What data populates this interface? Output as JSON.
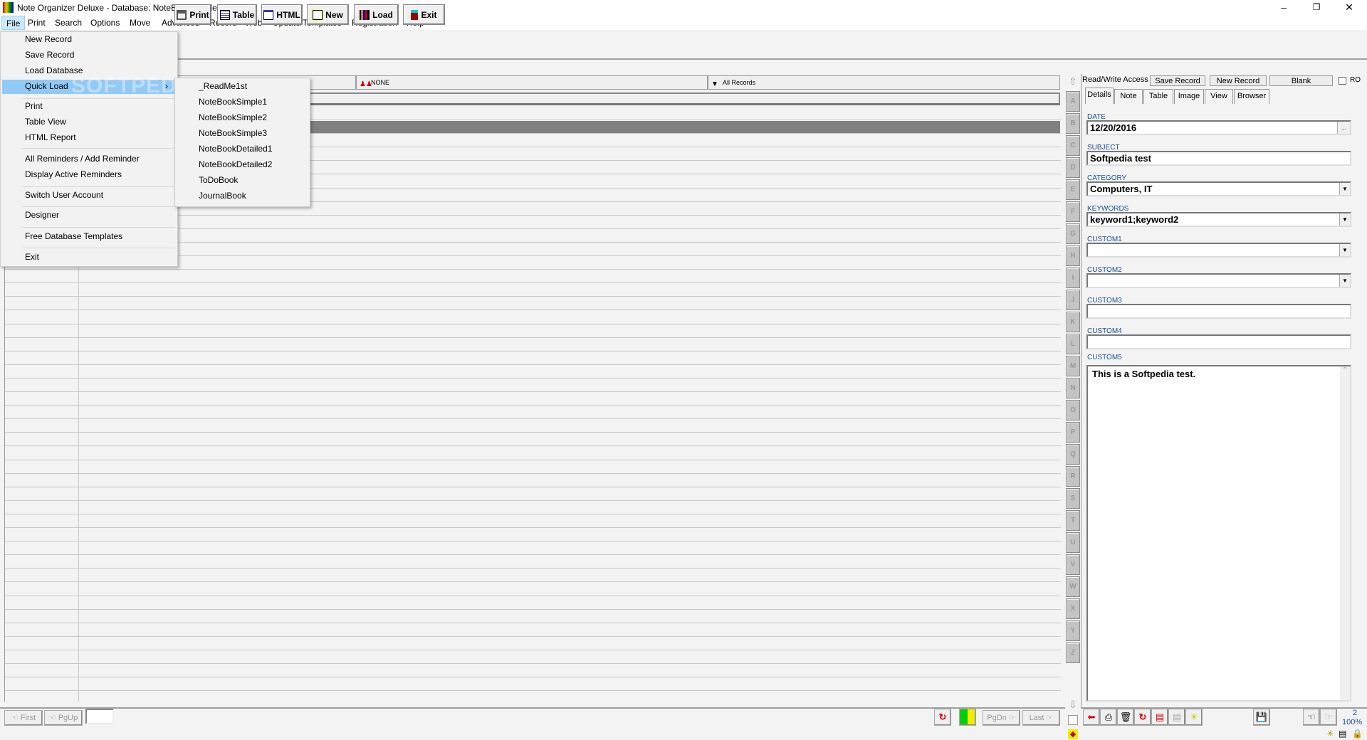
{
  "window": {
    "title": "Note Organizer Deluxe - Database: NoteBookDetailed2",
    "controls": [
      "minimize",
      "restore",
      "close"
    ]
  },
  "menubar": [
    "File",
    "Print",
    "Search",
    "Options",
    "Move",
    "Advanced",
    "Record",
    "Web",
    "Update/Templates",
    "Registration",
    "Help"
  ],
  "toolbar": {
    "buttons": [
      "Print",
      "Table",
      "HTML",
      "New",
      "Load",
      "Exit"
    ]
  },
  "grid": {
    "header": {
      "col2": "NONE",
      "col3": "All Records"
    }
  },
  "alphabet": [
    "A",
    "B",
    "C",
    "D",
    "E",
    "F",
    "G",
    "H",
    "I",
    "J",
    "K",
    "L",
    "M",
    "N",
    "O",
    "P",
    "Q",
    "R",
    "S",
    "T",
    "U",
    "V",
    "W",
    "X",
    "Y",
    "Z"
  ],
  "right_panel": {
    "access": "Read/Write Access",
    "save_record": "Save Record",
    "new_record": "New Record",
    "blank": "Blank",
    "ro": "RO",
    "tabs": [
      "Details",
      "Note",
      "Table",
      "Image",
      "View",
      "Browser"
    ],
    "fields": [
      {
        "label": "DATE",
        "value": "12/20/2016",
        "button": "..."
      },
      {
        "label": "SUBJECT",
        "value": "Softpedia test"
      },
      {
        "label": "CATEGORY",
        "value": "Computers, IT",
        "dropdown": true
      },
      {
        "label": "KEYWORDS",
        "value": "keyword1;keyword2",
        "dropdown": true
      },
      {
        "label": "CUSTOM1",
        "value": "",
        "dropdown": true
      },
      {
        "label": "CUSTOM2",
        "value": "",
        "dropdown": true
      },
      {
        "label": "CUSTOM3",
        "value": ""
      },
      {
        "label": "CUSTOM4",
        "value": ""
      }
    ],
    "custom5": {
      "label": "CUSTOM5",
      "value": "This is a Softpedia test."
    },
    "record_number": "2",
    "zoom": "100%"
  },
  "bottom_nav": {
    "first": "First",
    "pgup": "PgUp",
    "pgdn": "PgDn",
    "last": "Last",
    "page_input": ""
  },
  "file_menu": {
    "items": [
      "New Record",
      "Save Record",
      "Load Database",
      "Quick Load",
      "Print",
      "Table View",
      "HTML Report",
      "All Reminders / Add Reminder",
      "Display Active Reminders",
      "Switch User Account",
      "Designer",
      "Free Database Templates",
      "Exit"
    ],
    "highlighted": "Quick Load"
  },
  "quick_load_submenu": [
    "_ReadMe1st",
    "NoteBookSimple1",
    "NoteBookSimple2",
    "NoteBookSimple3",
    "NoteBookDetailed1",
    "NoteBookDetailed2",
    "ToDoBook",
    "JournalBook"
  ],
  "watermark": "SOFTPEDIA"
}
